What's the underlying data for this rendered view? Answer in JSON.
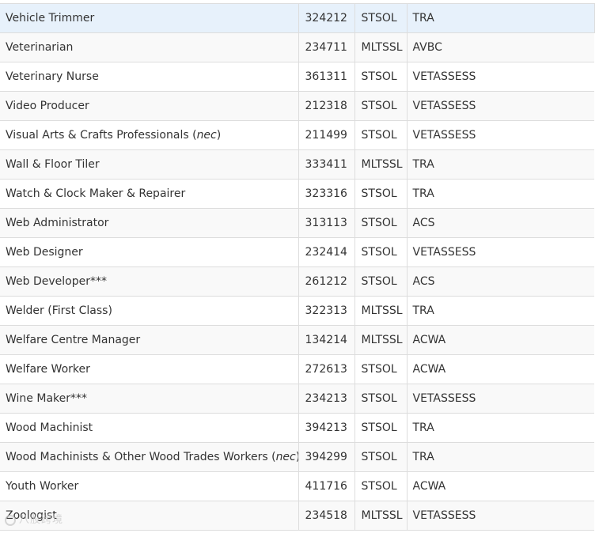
{
  "rows": [
    {
      "occupation": "Vehicle Trimmer",
      "nec": "",
      "code": "324212",
      "list": "STSOL",
      "authority": "TRA"
    },
    {
      "occupation": "Veterinarian",
      "nec": "",
      "code": "234711",
      "list": "MLTSSL",
      "authority": "AVBC"
    },
    {
      "occupation": "Veterinary Nurse",
      "nec": "",
      "code": "361311",
      "list": "STSOL",
      "authority": "VETASSESS"
    },
    {
      "occupation": "Video Producer",
      "nec": "",
      "code": "212318",
      "list": "STSOL",
      "authority": "VETASSESS"
    },
    {
      "occupation": "Visual Arts & Crafts Professionals (",
      "nec": "nec",
      "nec_close": ")",
      "code": "211499",
      "list": "STSOL",
      "authority": "VETASSESS"
    },
    {
      "occupation": "Wall & Floor Tiler",
      "nec": "",
      "code": "333411",
      "list": "MLTSSL",
      "authority": "TRA"
    },
    {
      "occupation": "Watch & Clock Maker & Repairer",
      "nec": "",
      "code": "323316",
      "list": "STSOL",
      "authority": "TRA"
    },
    {
      "occupation": "Web Administrator",
      "nec": "",
      "code": "313113",
      "list": "STSOL",
      "authority": "ACS"
    },
    {
      "occupation": "Web Designer",
      "nec": "",
      "code": "232414",
      "list": "STSOL",
      "authority": "VETASSESS"
    },
    {
      "occupation": "Web Developer***",
      "nec": "",
      "code": "261212",
      "list": "STSOL",
      "authority": "ACS"
    },
    {
      "occupation": "Welder (First Class)",
      "nec": "",
      "code": "322313",
      "list": "MLTSSL",
      "authority": "TRA"
    },
    {
      "occupation": "Welfare Centre Manager",
      "nec": "",
      "code": "134214",
      "list": "MLTSSL",
      "authority": "ACWA"
    },
    {
      "occupation": "Welfare Worker",
      "nec": "",
      "code": "272613",
      "list": "STSOL",
      "authority": "ACWA"
    },
    {
      "occupation": "Wine Maker***",
      "nec": "",
      "code": "234213",
      "list": "STSOL",
      "authority": "VETASSESS"
    },
    {
      "occupation": "Wood Machinist",
      "nec": "",
      "code": "394213",
      "list": "STSOL",
      "authority": "TRA"
    },
    {
      "occupation": "Wood Machinists & Other Wood Trades Workers (",
      "nec": "nec",
      "nec_close": ")",
      "code": "394299",
      "list": "STSOL",
      "authority": "TRA"
    },
    {
      "occupation": "Youth Worker",
      "nec": "",
      "code": "411716",
      "list": "STSOL",
      "authority": "ACWA"
    },
    {
      "occupation": "Zoologist",
      "nec": "",
      "code": "234518",
      "list": "MLTSSL",
      "authority": "VETASSESS"
    }
  ],
  "watermark": {
    "text": "八股跨境",
    "icon": "watermark-logo-icon"
  },
  "colors": {
    "highlight_row": "#e7f1fb",
    "border": "#dddddd",
    "text": "#333333"
  }
}
